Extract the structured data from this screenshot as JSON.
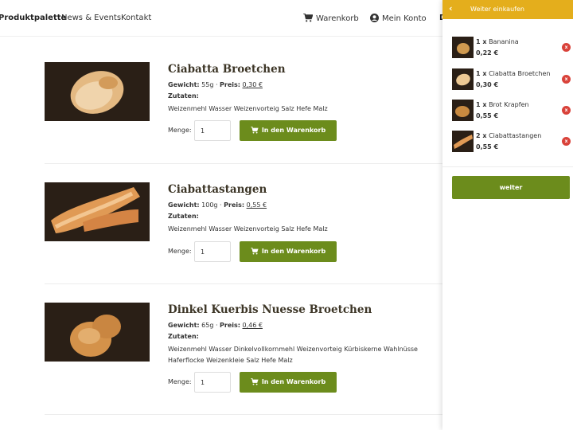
{
  "nav": {
    "produktpalette": "Produktpalette",
    "news": "News & Events",
    "kontakt": "Kontakt",
    "warenkorb": "Warenkorb",
    "konto": "Mein Konto",
    "cut_item": "D"
  },
  "labels": {
    "gewicht": "Gewicht:",
    "preis": "Preis:",
    "separator": "·",
    "zutaten": "Zutaten:",
    "menge": "Menge:",
    "add_to_cart": "In den Warenkorb"
  },
  "products": [
    {
      "title": "Ciabatta Broetchen",
      "weight": "55g",
      "price": "0,30 €",
      "ingredients": "Weizenmehl Wasser Weizenvorteig Salz Hefe Malz",
      "qty": "1"
    },
    {
      "title": "Ciabattastangen",
      "weight": "100g",
      "price": "0,55 €",
      "ingredients": "Weizenmehl Wasser Weizenvorteig Salz Hefe Malz",
      "qty": "1"
    },
    {
      "title": "Dinkel Kuerbis Nuesse Broetchen",
      "weight": "65g",
      "price": "0,46 €",
      "ingredients": "Weizenmehl Wasser Dinkelvollkornmehl Weizenvorteig Kürbiskerne Wahlnüsse Haferflocke Weizenkleie Salz Hefe Malz",
      "qty": "1"
    }
  ],
  "cart": {
    "back_icon": "‹",
    "header": "Weiter einkaufen",
    "remove_label": "x",
    "items": [
      {
        "qty": "1 x",
        "name": "Bananina",
        "price": "0,22 €"
      },
      {
        "qty": "1 x",
        "name": "Ciabatta Broetchen",
        "price": "0,30 €"
      },
      {
        "qty": "1 x",
        "name": "Brot Krapfen",
        "price": "0,55 €"
      },
      {
        "qty": "2 x",
        "name": "Ciabattastangen",
        "price": "0,55 €"
      }
    ],
    "continue_label": "weiter"
  },
  "colors": {
    "accent_green": "#6c8c1c",
    "header_yellow": "#e4ae1c",
    "remove_red": "#d9423a"
  }
}
